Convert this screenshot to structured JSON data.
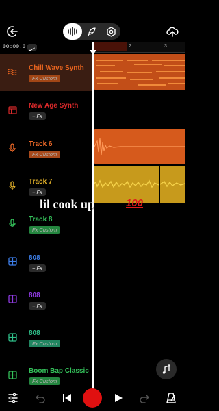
{
  "topbar": {
    "back_icon": "login-arrow-icon",
    "tabs": [
      {
        "name": "waveform-icon",
        "active": true
      },
      {
        "name": "feather-icon",
        "active": false
      },
      {
        "name": "settings-hex-icon",
        "active": false
      }
    ],
    "upload_icon": "cloud-upload-icon"
  },
  "ruler": {
    "time": "00:00.0",
    "ticks": [
      "2",
      "3"
    ]
  },
  "tracks": [
    {
      "name": "Chill Wave Synth",
      "chip": "Fx Custom",
      "chip_type": "custom",
      "color": "#e8641f",
      "icon": "synth-wave-icon",
      "selected": true
    },
    {
      "name": "New Age Synth",
      "chip": "+ Fx",
      "chip_type": "add",
      "color": "#d9292a",
      "icon": "synth-keys-icon",
      "selected": false
    },
    {
      "name": "Track 6",
      "chip": "Fx Custom",
      "chip_type": "custom",
      "color": "#f06a28",
      "icon": "microphone-icon",
      "selected": false
    },
    {
      "name": "Track 7",
      "chip": "+ Fx",
      "chip_type": "add",
      "color": "#e6b42a",
      "icon": "microphone-icon",
      "selected": false
    },
    {
      "name": "Track 8",
      "chip": "Fx Custom",
      "chip_type": "custom",
      "color": "#34c05a",
      "icon": "microphone-icon",
      "selected": false
    },
    {
      "name": "808",
      "chip": "+ Fx",
      "chip_type": "add",
      "color": "#3d7ee8",
      "icon": "drum-pad-icon",
      "selected": false
    },
    {
      "name": "808",
      "chip": "+ Fx",
      "chip_type": "add",
      "color": "#8e3ae0",
      "icon": "drum-pad-icon",
      "selected": false
    },
    {
      "name": "808",
      "chip": "Fx Custom",
      "chip_type": "custom",
      "color": "#2fc08a",
      "icon": "drum-pad-icon",
      "selected": false
    },
    {
      "name": "Boom Bap Classic",
      "chip": "Fx Custom",
      "chip_type": "custom",
      "color": "#34c05a",
      "icon": "drum-pad-icon",
      "selected": false
    }
  ],
  "overlay": {
    "caption": "lil cook up",
    "emoji_text": "100"
  },
  "bottombar": {
    "mixer_icon": "sliders-icon",
    "undo_icon": "undo-icon",
    "skip_back_icon": "skip-back-icon",
    "record_icon": "record-icon",
    "play_icon": "play-icon",
    "redo_icon": "redo-icon",
    "metronome_icon": "metronome-icon",
    "add_track_icon": "add-music-icon"
  },
  "colors": {
    "accent_orange": "#e8641f",
    "record_red": "#e01010"
  }
}
